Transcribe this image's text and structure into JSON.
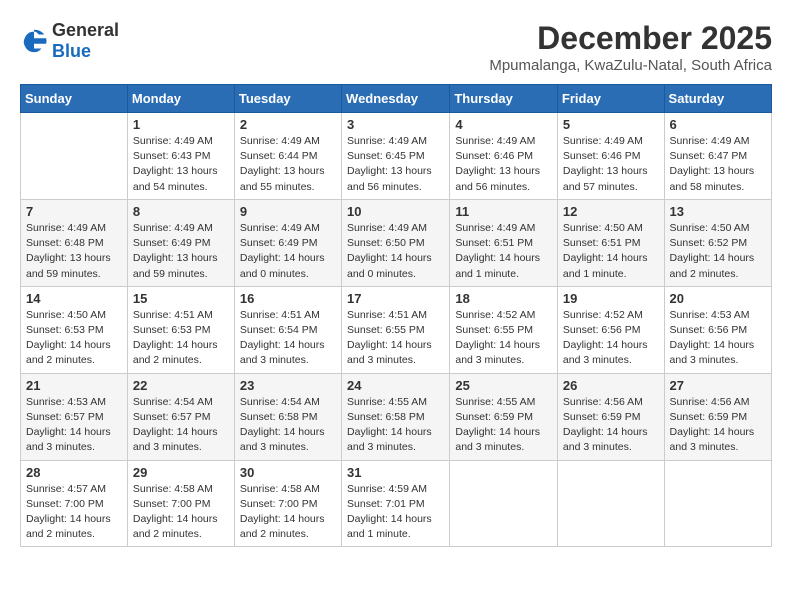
{
  "logo": {
    "general": "General",
    "blue": "Blue"
  },
  "title": {
    "month": "December 2025",
    "location": "Mpumalanga, KwaZulu-Natal, South Africa"
  },
  "headers": [
    "Sunday",
    "Monday",
    "Tuesday",
    "Wednesday",
    "Thursday",
    "Friday",
    "Saturday"
  ],
  "weeks": [
    [
      {
        "day": "",
        "info": ""
      },
      {
        "day": "1",
        "info": "Sunrise: 4:49 AM\nSunset: 6:43 PM\nDaylight: 13 hours\nand 54 minutes."
      },
      {
        "day": "2",
        "info": "Sunrise: 4:49 AM\nSunset: 6:44 PM\nDaylight: 13 hours\nand 55 minutes."
      },
      {
        "day": "3",
        "info": "Sunrise: 4:49 AM\nSunset: 6:45 PM\nDaylight: 13 hours\nand 56 minutes."
      },
      {
        "day": "4",
        "info": "Sunrise: 4:49 AM\nSunset: 6:46 PM\nDaylight: 13 hours\nand 56 minutes."
      },
      {
        "day": "5",
        "info": "Sunrise: 4:49 AM\nSunset: 6:46 PM\nDaylight: 13 hours\nand 57 minutes."
      },
      {
        "day": "6",
        "info": "Sunrise: 4:49 AM\nSunset: 6:47 PM\nDaylight: 13 hours\nand 58 minutes."
      }
    ],
    [
      {
        "day": "7",
        "info": "Sunrise: 4:49 AM\nSunset: 6:48 PM\nDaylight: 13 hours\nand 59 minutes."
      },
      {
        "day": "8",
        "info": "Sunrise: 4:49 AM\nSunset: 6:49 PM\nDaylight: 13 hours\nand 59 minutes."
      },
      {
        "day": "9",
        "info": "Sunrise: 4:49 AM\nSunset: 6:49 PM\nDaylight: 14 hours\nand 0 minutes."
      },
      {
        "day": "10",
        "info": "Sunrise: 4:49 AM\nSunset: 6:50 PM\nDaylight: 14 hours\nand 0 minutes."
      },
      {
        "day": "11",
        "info": "Sunrise: 4:49 AM\nSunset: 6:51 PM\nDaylight: 14 hours\nand 1 minute."
      },
      {
        "day": "12",
        "info": "Sunrise: 4:50 AM\nSunset: 6:51 PM\nDaylight: 14 hours\nand 1 minute."
      },
      {
        "day": "13",
        "info": "Sunrise: 4:50 AM\nSunset: 6:52 PM\nDaylight: 14 hours\nand 2 minutes."
      }
    ],
    [
      {
        "day": "14",
        "info": "Sunrise: 4:50 AM\nSunset: 6:53 PM\nDaylight: 14 hours\nand 2 minutes."
      },
      {
        "day": "15",
        "info": "Sunrise: 4:51 AM\nSunset: 6:53 PM\nDaylight: 14 hours\nand 2 minutes."
      },
      {
        "day": "16",
        "info": "Sunrise: 4:51 AM\nSunset: 6:54 PM\nDaylight: 14 hours\nand 3 minutes."
      },
      {
        "day": "17",
        "info": "Sunrise: 4:51 AM\nSunset: 6:55 PM\nDaylight: 14 hours\nand 3 minutes."
      },
      {
        "day": "18",
        "info": "Sunrise: 4:52 AM\nSunset: 6:55 PM\nDaylight: 14 hours\nand 3 minutes."
      },
      {
        "day": "19",
        "info": "Sunrise: 4:52 AM\nSunset: 6:56 PM\nDaylight: 14 hours\nand 3 minutes."
      },
      {
        "day": "20",
        "info": "Sunrise: 4:53 AM\nSunset: 6:56 PM\nDaylight: 14 hours\nand 3 minutes."
      }
    ],
    [
      {
        "day": "21",
        "info": "Sunrise: 4:53 AM\nSunset: 6:57 PM\nDaylight: 14 hours\nand 3 minutes."
      },
      {
        "day": "22",
        "info": "Sunrise: 4:54 AM\nSunset: 6:57 PM\nDaylight: 14 hours\nand 3 minutes."
      },
      {
        "day": "23",
        "info": "Sunrise: 4:54 AM\nSunset: 6:58 PM\nDaylight: 14 hours\nand 3 minutes."
      },
      {
        "day": "24",
        "info": "Sunrise: 4:55 AM\nSunset: 6:58 PM\nDaylight: 14 hours\nand 3 minutes."
      },
      {
        "day": "25",
        "info": "Sunrise: 4:55 AM\nSunset: 6:59 PM\nDaylight: 14 hours\nand 3 minutes."
      },
      {
        "day": "26",
        "info": "Sunrise: 4:56 AM\nSunset: 6:59 PM\nDaylight: 14 hours\nand 3 minutes."
      },
      {
        "day": "27",
        "info": "Sunrise: 4:56 AM\nSunset: 6:59 PM\nDaylight: 14 hours\nand 3 minutes."
      }
    ],
    [
      {
        "day": "28",
        "info": "Sunrise: 4:57 AM\nSunset: 7:00 PM\nDaylight: 14 hours\nand 2 minutes."
      },
      {
        "day": "29",
        "info": "Sunrise: 4:58 AM\nSunset: 7:00 PM\nDaylight: 14 hours\nand 2 minutes."
      },
      {
        "day": "30",
        "info": "Sunrise: 4:58 AM\nSunset: 7:00 PM\nDaylight: 14 hours\nand 2 minutes."
      },
      {
        "day": "31",
        "info": "Sunrise: 4:59 AM\nSunset: 7:01 PM\nDaylight: 14 hours\nand 1 minute."
      },
      {
        "day": "",
        "info": ""
      },
      {
        "day": "",
        "info": ""
      },
      {
        "day": "",
        "info": ""
      }
    ]
  ]
}
